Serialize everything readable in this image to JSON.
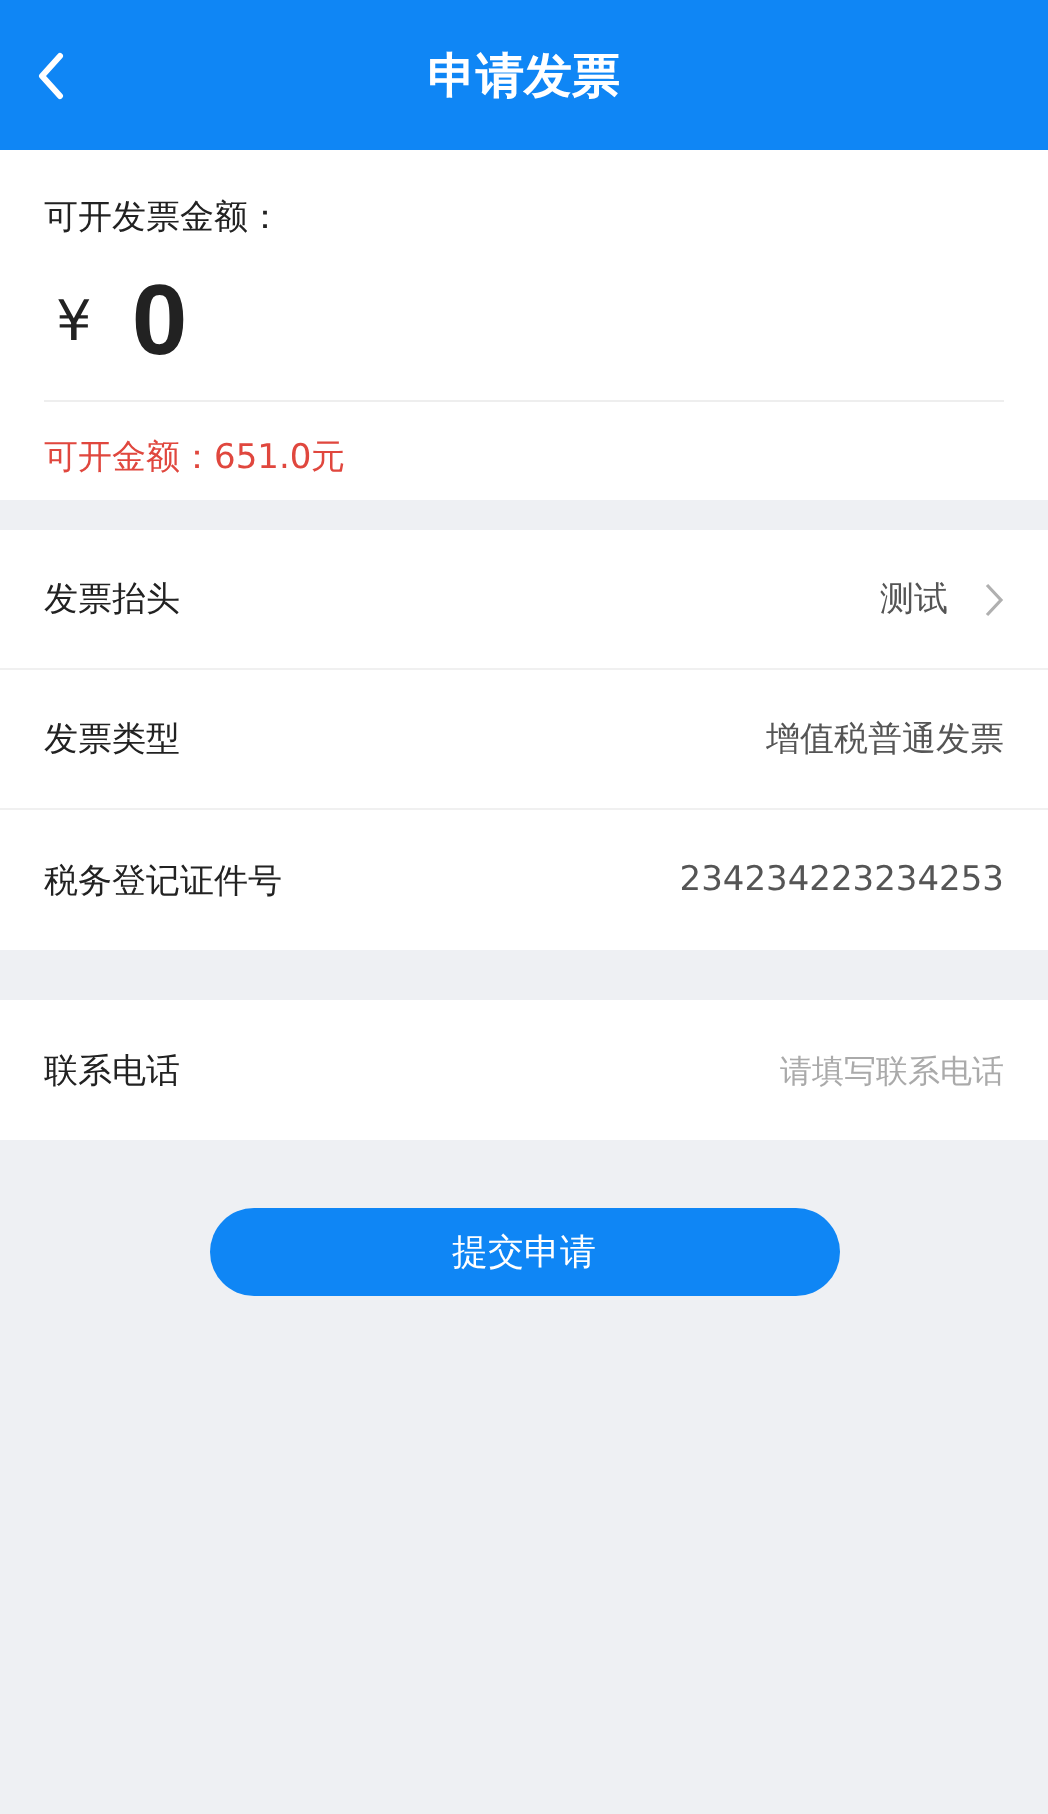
{
  "header": {
    "title": "申请发票"
  },
  "amount": {
    "label": "可开发票金额：",
    "currency": "¥",
    "value": "0",
    "available": "可开金额：651.0元"
  },
  "sections": [
    {
      "rows": [
        {
          "kind": "link",
          "label": "发票抬头",
          "value": "测试"
        },
        {
          "kind": "text",
          "label": "发票类型",
          "value": "增值税普通发票"
        },
        {
          "kind": "text",
          "label": "税务登记证件号",
          "value": "234234223234253"
        }
      ]
    },
    {
      "rows": [
        {
          "kind": "input",
          "label": "联系电话",
          "placeholder": "请填写联系电话"
        }
      ]
    }
  ],
  "submit_button": "提交申请"
}
